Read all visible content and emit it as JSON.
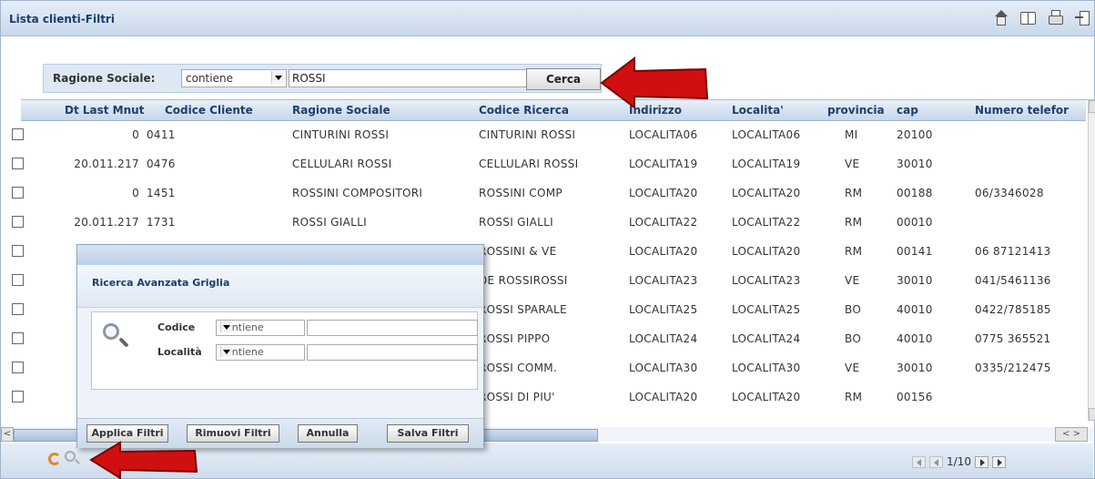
{
  "window": {
    "title": "Lista clienti-Filtri",
    "icons": [
      "home-icon",
      "book-icon",
      "print-icon",
      "exit-icon"
    ]
  },
  "filter": {
    "label": "Ragione Sociale:",
    "operator": "contiene",
    "value": "ROSSI",
    "search_button": "Cerca"
  },
  "grid": {
    "columns": [
      "Dt Last Mnut",
      "Codice Cliente",
      "Ragione Sociale",
      "Codice Ricerca",
      "Indirizzo",
      "Localita'",
      "provincia",
      "cap",
      "Numero telefor"
    ],
    "rows": [
      {
        "dt": "0",
        "codice": "0411",
        "ragione": "CINTURINI ROSSI",
        "ricerca": "CINTURINI ROSSI",
        "indirizzo": "LOCALITA06",
        "localita": "LOCALITA06",
        "provincia": "MI",
        "cap": "20100",
        "telefono": ""
      },
      {
        "dt": "20.011.217",
        "codice": "0476",
        "ragione": "CELLULARI ROSSI",
        "ricerca": "CELLULARI ROSSI",
        "indirizzo": "LOCALITA19",
        "localita": "LOCALITA19",
        "provincia": "VE",
        "cap": "30010",
        "telefono": ""
      },
      {
        "dt": "0",
        "codice": "1451",
        "ragione": "ROSSINI COMPOSITORI",
        "ricerca": "ROSSINI COMP",
        "indirizzo": "LOCALITA20",
        "localita": "LOCALITA20",
        "provincia": "RM",
        "cap": "00188",
        "telefono": "06/3346028"
      },
      {
        "dt": "20.011.217",
        "codice": "1731",
        "ragione": "ROSSI GIALLI",
        "ricerca": "ROSSI GIALLI",
        "indirizzo": "LOCALITA22",
        "localita": "LOCALITA22",
        "provincia": "RM",
        "cap": "00010",
        "telefono": ""
      },
      {
        "dt": "",
        "codice": "",
        "ragione": "",
        "ricerca": "ROSSINI & VE",
        "indirizzo": "LOCALITA20",
        "localita": "LOCALITA20",
        "provincia": "RM",
        "cap": "00141",
        "telefono": "06 87121413"
      },
      {
        "dt": "",
        "codice": "",
        "ragione": "",
        "ricerca": "DE ROSSIROSSI",
        "indirizzo": "LOCALITA23",
        "localita": "LOCALITA23",
        "provincia": "VE",
        "cap": "30010",
        "telefono": "041/5461136"
      },
      {
        "dt": "",
        "codice": "",
        "ragione": "",
        "ricerca": "ROSSI SPARALE",
        "indirizzo": "LOCALITA25",
        "localita": "LOCALITA25",
        "provincia": "BO",
        "cap": "40010",
        "telefono": "0422/785185"
      },
      {
        "dt": "",
        "codice": "",
        "ragione": "",
        "ricerca": "ROSSI PIPPO",
        "indirizzo": "LOCALITA24",
        "localita": "LOCALITA24",
        "provincia": "BO",
        "cap": "40010",
        "telefono": "0775 365521"
      },
      {
        "dt": "",
        "codice": "",
        "ragione": "",
        "ricerca": "ROSSI COMM.",
        "indirizzo": "LOCALITA30",
        "localita": "LOCALITA30",
        "provincia": "VE",
        "cap": "30010",
        "telefono": "0335/212475"
      },
      {
        "dt": "",
        "codice": "",
        "ragione": "",
        "ricerca": "ROSSI DI PIU'",
        "indirizzo": "LOCALITA20",
        "localita": "LOCALITA20",
        "provincia": "RM",
        "cap": "00156",
        "telefono": ""
      }
    ]
  },
  "pager": {
    "page_info": "1/10"
  },
  "dialog": {
    "title": "Ricerca Avanzata Griglia",
    "fields": [
      {
        "label": "Codice",
        "operator": "contiene",
        "value": ""
      },
      {
        "label": "Località",
        "operator": "contiene",
        "value": ""
      }
    ],
    "buttons": [
      "Applica Filtri",
      "Rimuovi Filtri",
      "Annulla",
      "Salva Filtri"
    ]
  },
  "colors": {
    "header_text": "#1a3f6e",
    "arrow_red": "#d01010",
    "refresh_orange": "#e0892a"
  }
}
